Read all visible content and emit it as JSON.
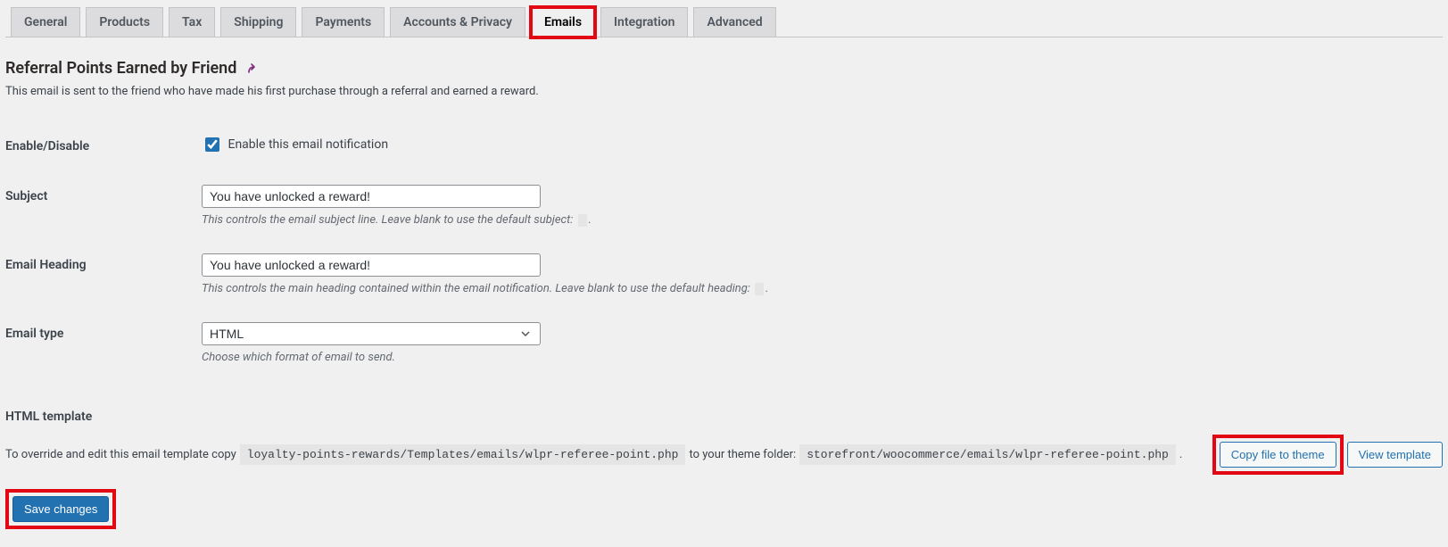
{
  "tabs": [
    {
      "label": "General"
    },
    {
      "label": "Products"
    },
    {
      "label": "Tax"
    },
    {
      "label": "Shipping"
    },
    {
      "label": "Payments"
    },
    {
      "label": "Accounts & Privacy"
    },
    {
      "label": "Emails",
      "active": true
    },
    {
      "label": "Integration"
    },
    {
      "label": "Advanced"
    }
  ],
  "section": {
    "title": "Referral Points Earned by Friend",
    "desc": "This email is sent to the friend who have made his first purchase through a referral and earned a reward."
  },
  "fields": {
    "enable": {
      "label": "Enable/Disable",
      "cb_label": "Enable this email notification",
      "checked": true
    },
    "subject": {
      "label": "Subject",
      "value": "You have unlocked a reward!",
      "help_pre": "This controls the email subject line. Leave blank to use the default subject:",
      "help_post": "."
    },
    "heading": {
      "label": "Email Heading",
      "value": "You have unlocked a reward!",
      "help_pre": "This controls the main heading contained within the email notification. Leave blank to use the default heading:",
      "help_post": "."
    },
    "type": {
      "label": "Email type",
      "value": "HTML",
      "help": "Choose which format of email to send."
    }
  },
  "template": {
    "label": "HTML template",
    "text1": "To override and edit this email template copy",
    "path1": "loyalty-points-rewards/Templates/emails/wlpr-referee-point.php",
    "text2": "to your theme folder:",
    "path2": "storefront/woocommerce/emails/wlpr-referee-point.php",
    "dot": ".",
    "copy_btn": "Copy file to theme",
    "view_btn": "View template"
  },
  "save_btn": "Save changes"
}
